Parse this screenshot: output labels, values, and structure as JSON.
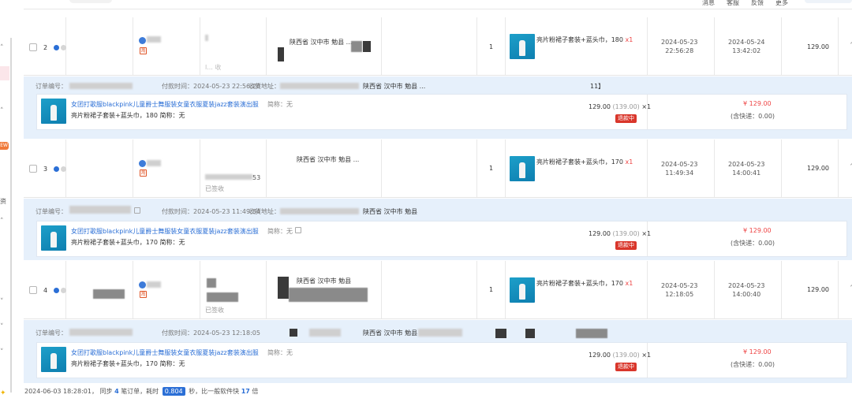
{
  "topbar": {
    "links": [
      "消息",
      "客服",
      "反馈",
      "更多"
    ]
  },
  "leftbar": {
    "new_badge": "EW",
    "glyph_text": "资"
  },
  "orders": [
    {
      "index": "2",
      "address_fragment": "陕西省 汉中市 勉县 ...",
      "buyer_note": "已签收",
      "qty": "1",
      "product": "亮片粉裙子套装+蓝头巾，180",
      "product_qty": "x1",
      "order_date": "2024-05-23",
      "order_time": "22:56:28",
      "ship_date": "2024-05-24",
      "ship_time": "13:42:02",
      "price": "129.00",
      "band": {
        "order_no_label": "订单编号：",
        "pay_time": "付款时间：2024-05-23 22:56:28",
        "address_label": "收货地址：",
        "address_fragment": "陕西省 汉中市 勉县 ...",
        "address_tail": "11】",
        "title": "女团打歌服blackpink儿童爵士舞服装女童衣服夏装jazz套装演出服",
        "sku": "亮片粉裙子套装+蓝头巾，180   简称：无",
        "abbr": "简称：无",
        "unit_price": "129.00",
        "unit_price_sub": "(139.00)",
        "unit_qty": "×1",
        "status": "退款中",
        "total": "¥ 129.00",
        "shipping": "(含快递：0.00)"
      }
    },
    {
      "index": "3",
      "address_fragment": "陕西省 汉中市 勉县 ...",
      "buyer_note": "已签收",
      "phone_tail": "53",
      "qty": "1",
      "product": "亮片粉裙子套装+蓝头巾，170",
      "product_qty": "x1",
      "order_date": "2024-05-23",
      "order_time": "11:49:34",
      "ship_date": "2024-05-23",
      "ship_time": "14:00:41",
      "price": "129.00",
      "band": {
        "order_no_label": "订单编号：",
        "pay_time": "付款时间：2024-05-23 11:49:34",
        "address_label": "收货地址：",
        "address_fragment": "陕西省 汉中市 勉县",
        "title": "女团打歌服blackpink儿童爵士舞服装女童衣服夏装jazz套装演出服",
        "sku": "亮片粉裙子套装+蓝头巾，170   简称：无",
        "abbr": "简称：无",
        "unit_price": "129.00",
        "unit_price_sub": "(139.00)",
        "unit_qty": "×1",
        "status": "退款中",
        "total": "¥ 129.00",
        "shipping": "(含快递：0.00)"
      }
    },
    {
      "index": "4",
      "address_fragment": "陕西省 汉中市 勉县",
      "buyer_note": "已签收",
      "qty": "1",
      "product": "亮片粉裙子套装+蓝头巾，170",
      "product_qty": "x1",
      "order_date": "2024-05-23",
      "order_time": "12:18:05",
      "ship_date": "2024-05-23",
      "ship_time": "14:00:40",
      "price": "129.00",
      "band": {
        "order_no_label": "订单编号：",
        "pay_time": "付款时间：2024-05-23 12:18:05",
        "address_label": "收货地址：",
        "address_fragment": "陕西省 汉中市 勉县",
        "title": "女团打歌服blackpink儿童爵士舞服装女童衣服夏装jazz套装演出服",
        "sku": "亮片粉裙子套装+蓝头巾，170   简称：无",
        "abbr": "简称：无",
        "unit_price": "129.00",
        "unit_price_sub": "(139.00)",
        "unit_qty": "×1",
        "status": "退款中",
        "total": "¥ 129.00",
        "shipping": "(含快递：0.00)"
      }
    }
  ],
  "footer": {
    "timestamp": "2024-06-03 18:28:01，",
    "sync_prefix": "同步",
    "sync_count": "4",
    "sync_mid": "笔订单，耗时",
    "elapsed": "0.804",
    "elapsed_unit": "秒，比一般软件快",
    "faster": "17",
    "faster_unit": "倍"
  },
  "colors": {
    "accent": "#2b6fd6",
    "band": "#e6f0fb",
    "refund": "#d9362b",
    "price_red": "#e44444"
  }
}
